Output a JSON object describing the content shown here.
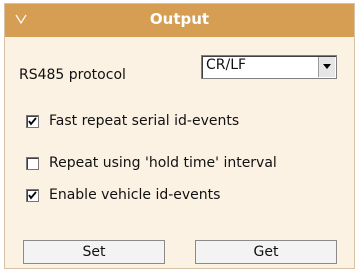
{
  "panel": {
    "title": "Output",
    "collapse_icon": "chevron-down-icon"
  },
  "protocol": {
    "label": "RS485 protocol",
    "selected": "CR/LF"
  },
  "options": [
    {
      "label": "Fast repeat serial id-events",
      "checked": true
    },
    {
      "label": "Repeat using 'hold time' interval",
      "checked": false
    },
    {
      "label": "Enable vehicle id-events",
      "checked": true
    }
  ],
  "buttons": {
    "set": "Set",
    "get": "Get"
  },
  "colors": {
    "header": "#d59e52",
    "panel_bg": "#fcf2e3"
  }
}
